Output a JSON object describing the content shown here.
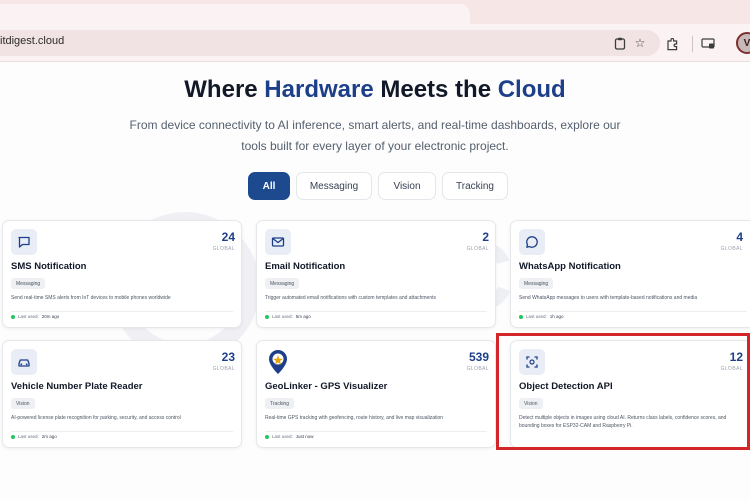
{
  "browser": {
    "url": "itdigest.cloud",
    "avatar_letter": "V"
  },
  "hero": {
    "title_part1": "Where ",
    "title_accent1": "Hardware",
    "title_part2": " Meets the ",
    "title_accent2": "Cloud",
    "subtitle_line1": "From device connectivity to AI inference, smart alerts, and real-time dashboards, explore our",
    "subtitle_line2": "tools built for every layer of your electronic project."
  },
  "watermark": {
    "text": "CIRCUIT"
  },
  "filters": [
    {
      "label": "All",
      "active": true
    },
    {
      "label": "Messaging",
      "active": false
    },
    {
      "label": "Vision",
      "active": false
    },
    {
      "label": "Tracking",
      "active": false
    }
  ],
  "cards": [
    {
      "icon": "chat-square-icon",
      "count": "24",
      "count_label": "GLOBAL",
      "name": "SMS Notification",
      "tag": "Messaging",
      "description": "Send real-time SMS alerts from IoT devices to mobile phones worldwide",
      "last_used_label": "Last used:",
      "last_used": "20m ago"
    },
    {
      "icon": "envelope-icon",
      "count": "2",
      "count_label": "GLOBAL",
      "name": "Email Notification",
      "tag": "Messaging",
      "description": "Trigger automated email notifications with custom templates and attachments",
      "last_used_label": "Last used:",
      "last_used": "5m ago"
    },
    {
      "icon": "whatsapp-bubble-icon",
      "count": "4",
      "count_label": "GLOBAL",
      "name": "WhatsApp Notification",
      "tag": "Messaging",
      "description": "Send WhatsApp messages to users with template-based notifications and media",
      "last_used_label": "Last used:",
      "last_used": "1h ago"
    },
    {
      "icon": "car-icon",
      "count": "23",
      "count_label": "GLOBAL",
      "name": "Vehicle Number Plate Reader",
      "tag": "Vision",
      "description": "AI-powered license plate recognition for parking, security, and access control",
      "last_used_label": "Last used:",
      "last_used": "2m ago"
    },
    {
      "icon": "map-pin-icon",
      "count": "539",
      "count_label": "GLOBAL",
      "name": "GeoLinker - GPS Visualizer",
      "tag": "Tracking",
      "description": "Real-time GPS tracking with geofencing, route history, and live map visualization",
      "last_used_label": "Last used:",
      "last_used": "Just now"
    },
    {
      "icon": "scan-target-icon",
      "count": "12",
      "count_label": "GLOBAL",
      "name": "Object Detection API",
      "tag": "Vision",
      "description": "Detect multiple objects in images using cloud AI. Returns class labels, confidence scores, and bounding boxes for ESP32-CAM and Raspberry Pi.",
      "last_used_label": "",
      "last_used": ""
    }
  ],
  "colors": {
    "accent": "#1d3f8a",
    "filter_active": "#1d4a8f",
    "highlight": "#d3262b",
    "online_dot": "#22c55e"
  }
}
